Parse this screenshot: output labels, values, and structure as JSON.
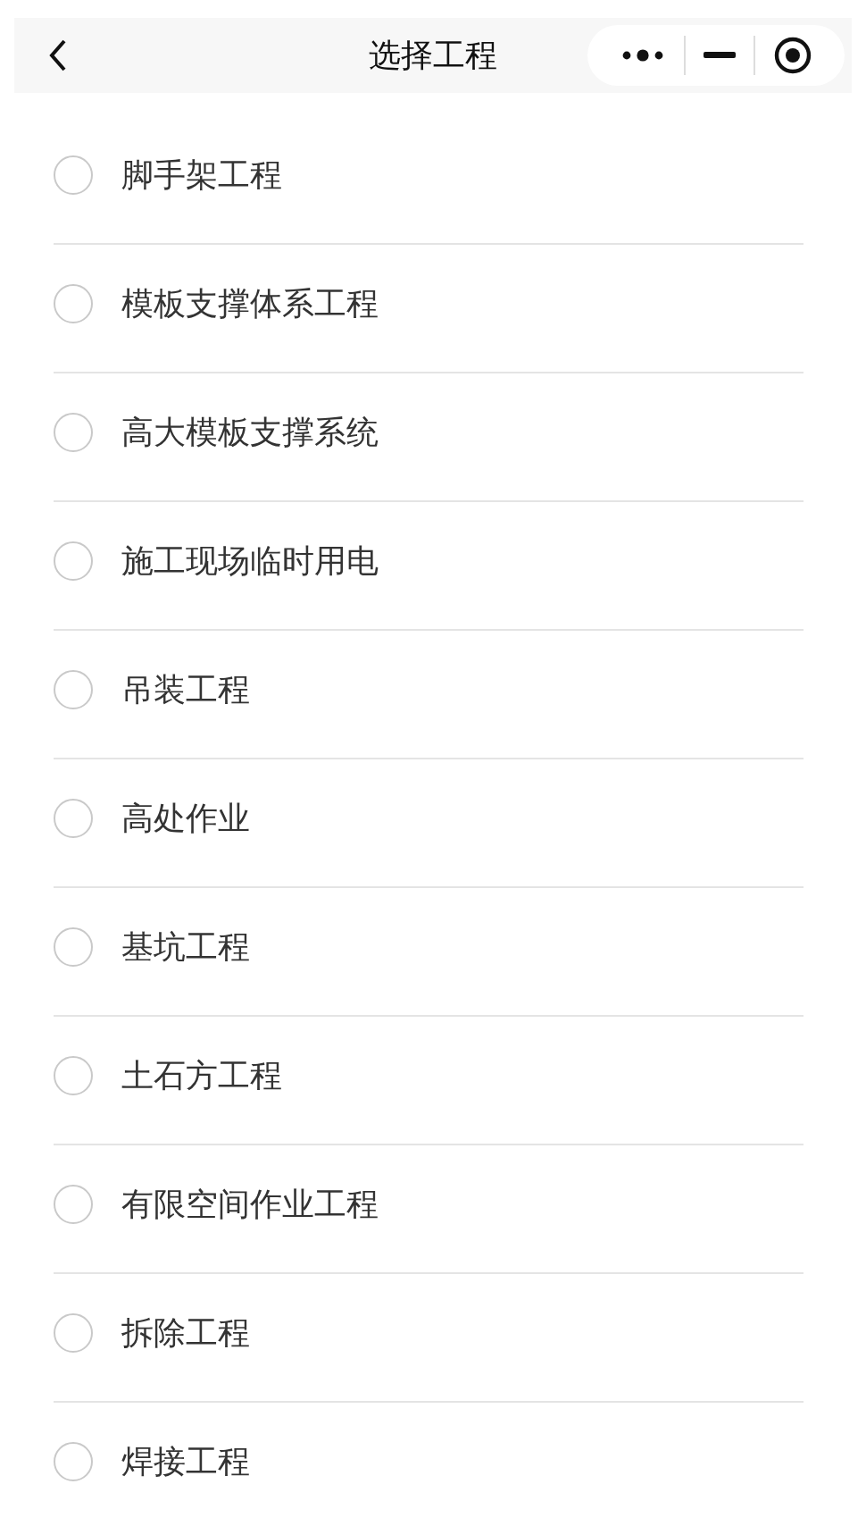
{
  "nav_bar": {
    "title": "选择工程"
  },
  "options": [
    {
      "label": "脚手架工程",
      "selected": false
    },
    {
      "label": "模板支撑体系工程",
      "selected": false
    },
    {
      "label": "高大模板支撑系统",
      "selected": false
    },
    {
      "label": "施工现场临时用电",
      "selected": false
    },
    {
      "label": "吊装工程",
      "selected": false
    },
    {
      "label": "高处作业",
      "selected": false
    },
    {
      "label": "基坑工程",
      "selected": false
    },
    {
      "label": "土石方工程",
      "selected": false
    },
    {
      "label": "有限空间作业工程",
      "selected": false
    },
    {
      "label": "拆除工程",
      "selected": false
    },
    {
      "label": "焊接工程",
      "selected": false
    }
  ]
}
